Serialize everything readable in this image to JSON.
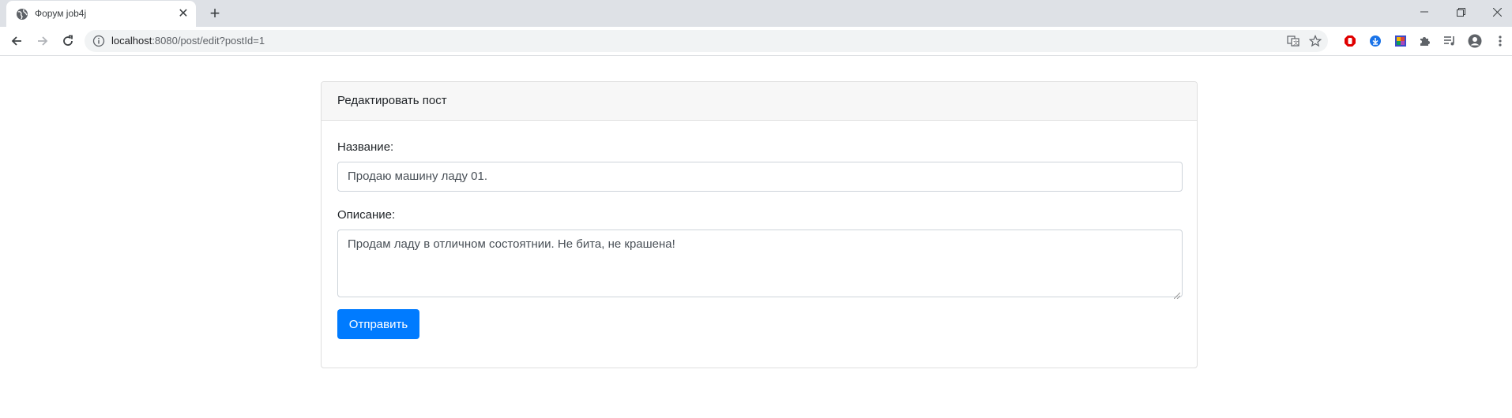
{
  "browser": {
    "tab": {
      "title": "Форум job4j",
      "favicon": "globe-icon"
    },
    "address_bar": {
      "host": "localhost",
      "rest": ":8080/post/edit?postId=1"
    },
    "accent": "#007bff"
  },
  "form": {
    "header": "Редактировать пост",
    "name_label": "Название:",
    "name_value": "Продаю машину ладу 01.",
    "description_label": "Описание:",
    "description_value": "Продам ладу в отличном состоятнии. Не бита, не крашена!",
    "submit_label": "Отправить"
  }
}
